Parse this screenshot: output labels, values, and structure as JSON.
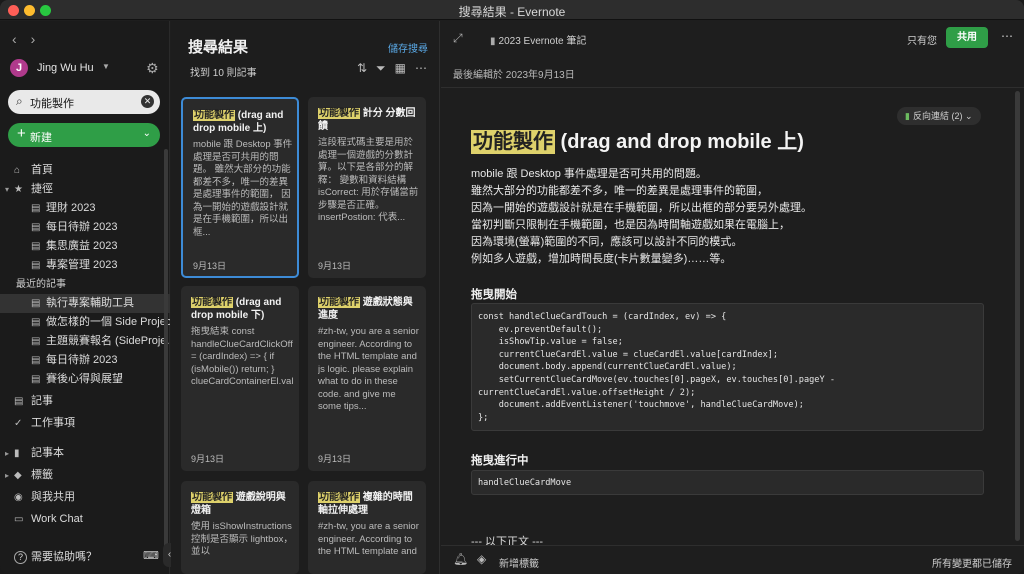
{
  "window": {
    "title": "搜尋結果 - Evernote"
  },
  "sidebar": {
    "back_icon": "‹",
    "forward_icon": "›",
    "avatar_letter": "J",
    "user_name": "Jing Wu Hu",
    "search_value": "功能製作",
    "new_label": "新建",
    "home": "首頁",
    "shortcuts": "捷徑",
    "shortcut_items": [
      "理財 2023",
      "每日待辦 2023",
      "集思廣益 2023",
      "專案管理 2023"
    ],
    "recent_label": "最近的記事",
    "recent_items": [
      "執行專案輔助工具",
      "做怎樣的一個 Side Project",
      "主題競賽報名 (SideProje...",
      "每日待辦 2023",
      "賽後心得與展望"
    ],
    "notes": "記事",
    "tasks": "工作事項",
    "notebooks": "記事本",
    "tags": "標籤",
    "shared": "與我共用",
    "chat": "Work Chat",
    "help": "需要協助嗎？"
  },
  "middle": {
    "title": "搜尋結果",
    "save_search": "儲存搜尋",
    "found": "找到 10 則記事",
    "cards": [
      {
        "hl": "功能製作",
        "title": " (drag and drop mobile 上)",
        "body": "mobile 跟 Desktop 事件處理是否可共用的問題。 雖然大部分的功能都差不多，唯一的差異是處理事件的範圍， 因為一開始的遊戲設計就是在手機範圍，所以出框...",
        "date": "9月13日"
      },
      {
        "hl": "功能製作",
        "title": " 計分 分數回饋",
        "body": "這段程式碼主要是用於處理一個遊戲的分數計算。以下是各部分的解釋： 變數和資料結構 isCorrect: 用於存儲當前步驟是否正確。 insertPostion: 代表...",
        "date": "9月13日"
      },
      {
        "hl": "功能製作",
        "title": " (drag and drop mobile 下)",
        "body": "拖曳結束 const handleClueCardClickOff = (cardIndex) => { if (isMobile()) return; } clueCardContainerEl.value.append(currentClueCardEl.value...",
        "date": "9月13日"
      },
      {
        "hl": "功能製作",
        "title": " 遊戲狀態與進度",
        "body": "#zh-tw, you are a senior engineer. According to the HTML template and js logic. please explain what to do in these code. and give me some tips...",
        "date": "9月13日"
      },
      {
        "hl": "功能製作",
        "title": " 遊戲說明與燈箱",
        "body": "使用 isShowInstructions 控制是否顯示 lightbox，並以",
        "date": ""
      },
      {
        "hl": "功能製作",
        "title": " 複雜的時間軸拉伸處理",
        "body": "#zh-tw, you are a senior engineer. According to the HTML template and",
        "date": ""
      }
    ]
  },
  "editor": {
    "notebook": "2023 Evernote 筆記",
    "only_you": "只有您",
    "share": "共用",
    "last_edited": "最後編輯於 2023年9月13日",
    "backlinks": "反向連結 (2)",
    "title_hl": "功能製作",
    "title_rest": " (drag and drop mobile 上)",
    "paragraph": [
      "mobile 跟 Desktop 事件處理是否可共用的問題。",
      "雖然大部分的功能都差不多，唯一的差異是處理事件的範圍，",
      "因為一開始的遊戲設計就是在手機範圍，所以出框的部分要另外處理。",
      "當初判斷只限制在手機範圍，也是因為時間軸遊戲如果在電腦上，",
      "因為環境(螢幕)範圍的不同，應該可以設計不同的模式。",
      "例如多人遊戲，增加時間長度(卡片數量變多)……等。"
    ],
    "heading1": "拖曳開始",
    "code1": [
      "const handleClueCardTouch = (cardIndex, ev) => {",
      "    ev.preventDefault();",
      "    isShowTip.value = false;",
      "    currentClueCardEl.value = clueCardEl.value[cardIndex];",
      "    document.body.append(currentClueCardEl.value);",
      "    setCurrentClueCardMove(ev.touches[0].pageX, ev.touches[0].pageY -",
      "currentClueCardEl.value.offsetHeight / 2);",
      "    document.addEventListener('touchmove', handleClueCardMove);",
      "};"
    ],
    "heading2": "拖曳進行中",
    "code2": "handleClueCardMove",
    "more": "--- 以下正文 ---",
    "add_tag": "新增標籤",
    "saved": "所有變更都已儲存"
  }
}
